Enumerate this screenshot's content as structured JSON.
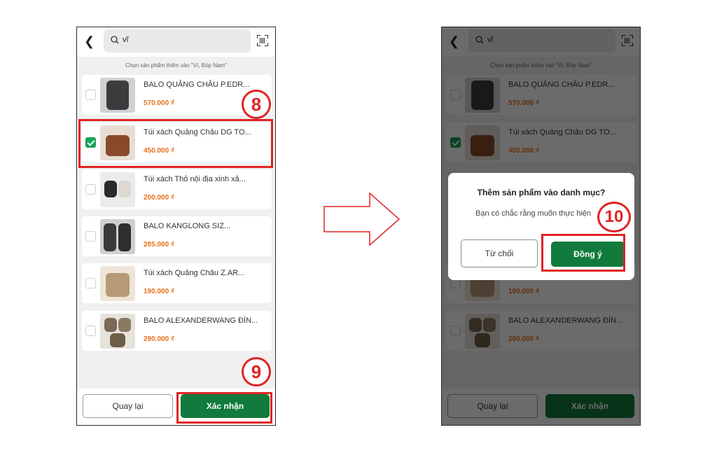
{
  "screen_before": {
    "search": {
      "back_icon": "chevron-left-icon",
      "search_icon": "magnifier-icon",
      "query": "vĩ",
      "scan_icon": "barcode-scan-icon"
    },
    "hint": "Chọn sản phẩm thêm vào  \"Ví, Bóp Nam\"",
    "products": [
      {
        "name": "BALO QUẢNG CHÂU P.EDR...",
        "price": "570.000 ₫",
        "checked": false
      },
      {
        "name": "Túi xách Quảng Châu DG TO...",
        "price": "450.000 ₫",
        "checked": true
      },
      {
        "name": "Túi xách Thỏ nội địa xinh xă...",
        "price": "200.000 ₫",
        "checked": false
      },
      {
        "name": "BALO KANGLONG SIZ...",
        "price": "285.000 ₫",
        "checked": false
      },
      {
        "name": "Túi xách Quảng Châu Z.AR...",
        "price": "190.000 ₫",
        "checked": false
      },
      {
        "name": "BALO ALEXANDERWANG ĐÍN...",
        "price": "290.000 ₫",
        "checked": false
      }
    ],
    "footer": {
      "back_label": "Quay lại",
      "confirm_label": "Xác nhận"
    }
  },
  "screen_after": {
    "dialog": {
      "title": "Thêm sản phẩm vào danh mục?",
      "message": "Bạn có chắc rằng muốn thực hiện",
      "reject_label": "Từ chối",
      "accept_label": "Đồng ý"
    }
  },
  "annotations": {
    "step_8": "8",
    "step_9": "9",
    "step_10": "10",
    "highlight_color": "#e02424",
    "arrow": "right-arrow-icon"
  },
  "colors": {
    "accent_green": "#117a3c",
    "price_orange": "#e8701a",
    "check_green": "#1aa255"
  }
}
